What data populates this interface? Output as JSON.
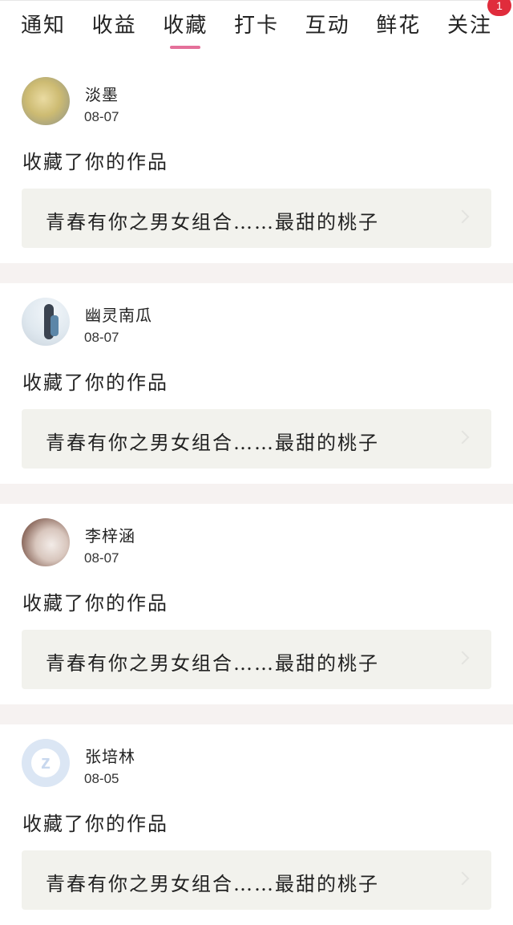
{
  "tabs": [
    {
      "label": "通知"
    },
    {
      "label": "收益"
    },
    {
      "label": "收藏",
      "active": true
    },
    {
      "label": "打卡"
    },
    {
      "label": "互动"
    },
    {
      "label": "鲜花"
    },
    {
      "label": "关注",
      "badge": "1"
    }
  ],
  "colors": {
    "active_indicator": "#e4709a",
    "badge": "#e02c3c",
    "card_bg": "#f2f2ed",
    "separator": "#f6f2f1"
  },
  "notifications": [
    {
      "user": "淡墨",
      "date": "08-07",
      "action": "收藏了你的作品",
      "work_title": "青春有你之男女组合……最甜的桃子"
    },
    {
      "user": "幽灵南瓜",
      "date": "08-07",
      "action": "收藏了你的作品",
      "work_title": "青春有你之男女组合……最甜的桃子"
    },
    {
      "user": "李梓涵",
      "date": "08-07",
      "action": "收藏了你的作品",
      "work_title": "青春有你之男女组合……最甜的桃子"
    },
    {
      "user": "张培林",
      "date": "08-05",
      "action": "收藏了你的作品",
      "work_title": "青春有你之男女组合……最甜的桃子"
    }
  ]
}
